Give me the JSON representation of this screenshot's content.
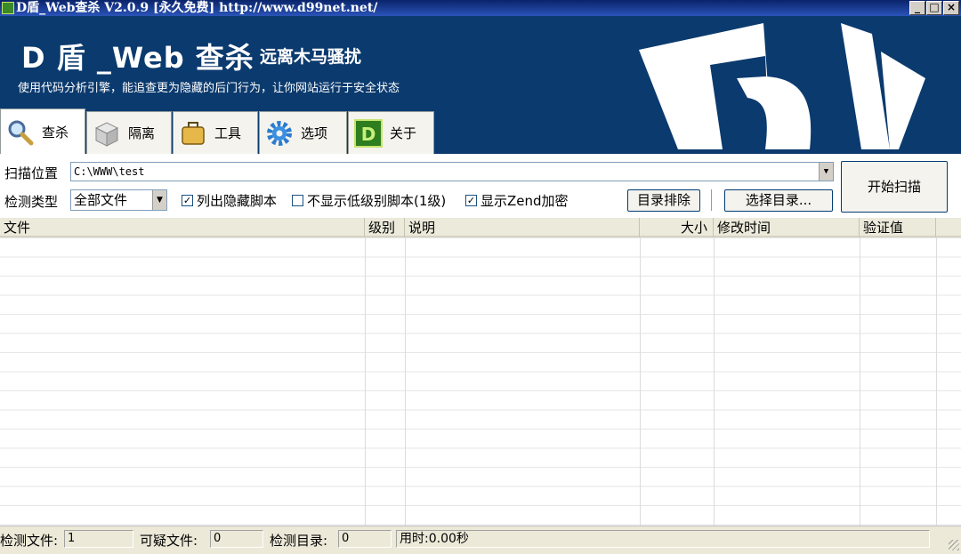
{
  "window": {
    "title": "D盾_Web查杀 V2.0.9 [永久免费] http://www.d99net.net/",
    "controls": [
      "_",
      "□",
      "×"
    ]
  },
  "banner": {
    "title": "D 盾 _Web 查杀",
    "subtitle": "远离木马骚扰",
    "description": "使用代码分析引擎，能追查更为隐藏的后门行为，让你网站运行于安全状态"
  },
  "tabs": [
    {
      "label": "查杀",
      "icon": "magnifier-icon",
      "active": true
    },
    {
      "label": "隔离",
      "icon": "box-icon",
      "active": false
    },
    {
      "label": "工具",
      "icon": "briefcase-icon",
      "active": false
    },
    {
      "label": "选项",
      "icon": "gear-icon",
      "active": false
    },
    {
      "label": "关于",
      "icon": "d-logo-icon",
      "active": false
    }
  ],
  "scan": {
    "location_label": "扫描位置",
    "location_value": "C:\\WWW\\test",
    "type_label": "检测类型",
    "type_value": "全部文件",
    "checkboxes": [
      {
        "label": "列出隐藏脚本",
        "checked": true
      },
      {
        "label": "不显示低级别脚本(1级)",
        "checked": false
      },
      {
        "label": "显示Zend加密",
        "checked": true
      }
    ],
    "exclude_button": "目录排除",
    "choose_dir_button": "选择目录...",
    "start_button": "开始扫描"
  },
  "table": {
    "columns": [
      "文件",
      "级别",
      "说明",
      "大小",
      "修改时间",
      "验证值"
    ],
    "rows": []
  },
  "status": {
    "files_label": "检测文件:",
    "files_value": "1",
    "suspicious_label": "可疑文件:",
    "suspicious_value": "0",
    "dirs_label": "检测目录:",
    "dirs_value": "0",
    "elapsed": "用时:0.00秒"
  },
  "colors": {
    "banner_bg": "#0b3a6e",
    "title_bar": "#0a246a"
  }
}
